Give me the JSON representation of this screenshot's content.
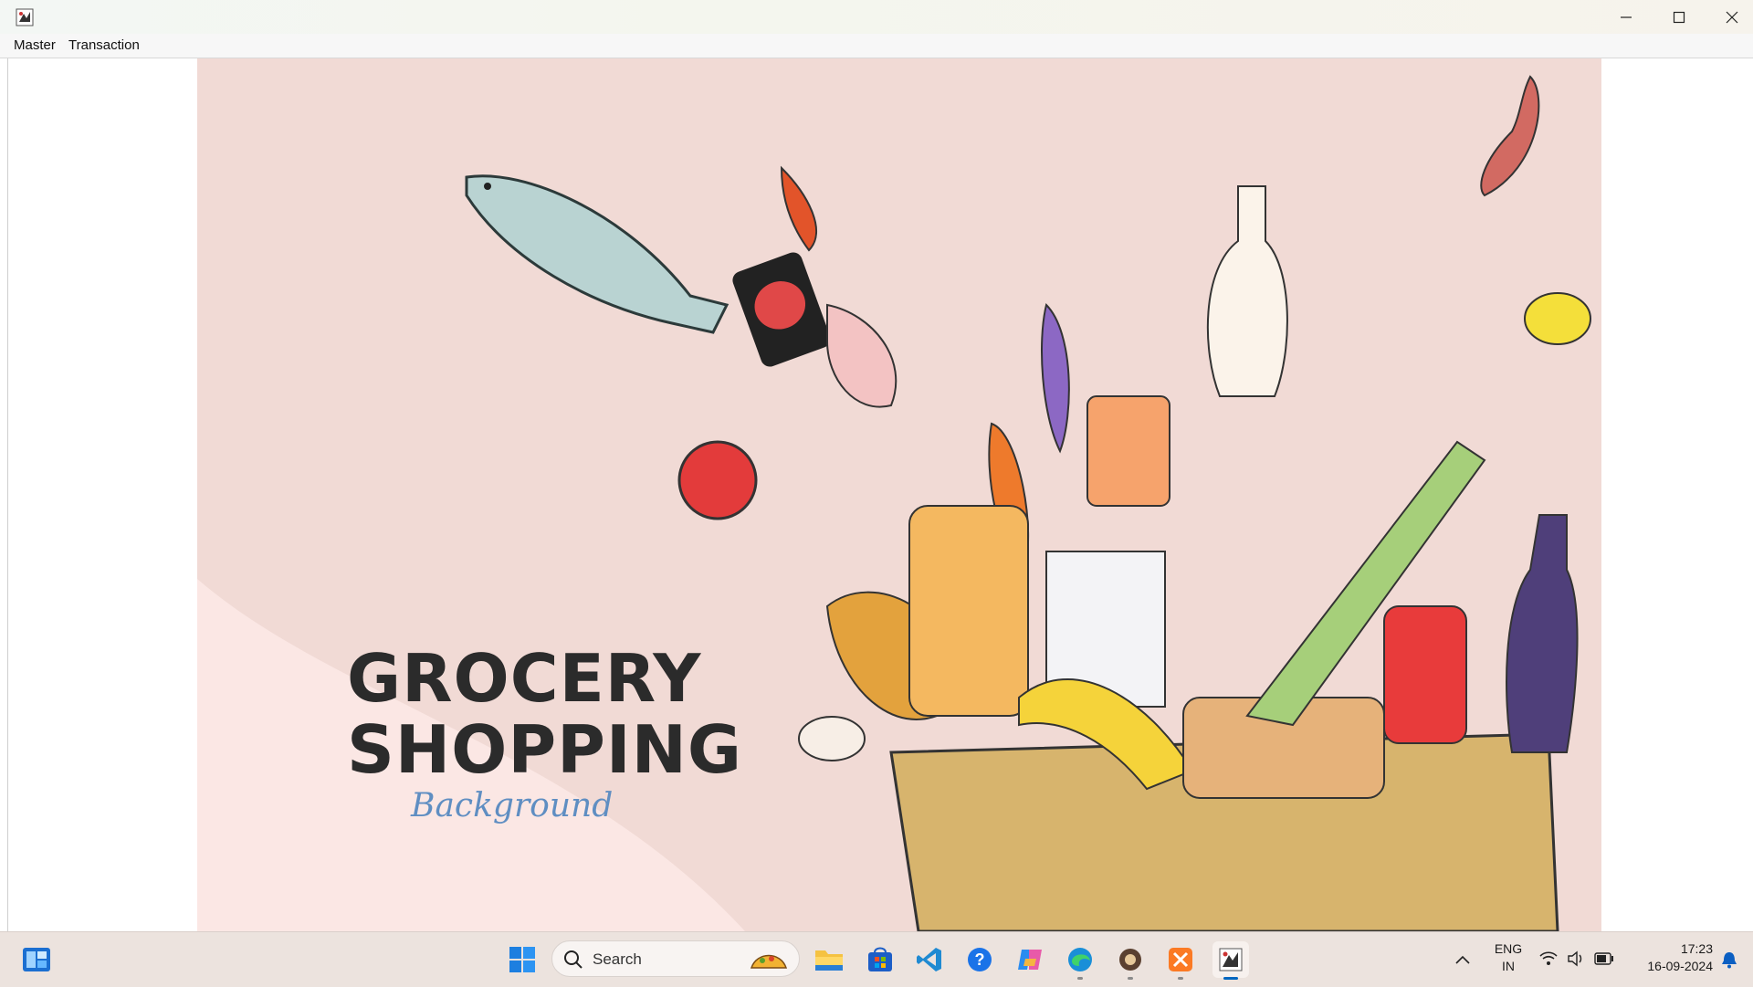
{
  "menu": {
    "items": [
      "Master",
      "Transaction"
    ]
  },
  "poster": {
    "title_line1": "GROCERY",
    "title_line2": "SHOPPING",
    "subtitle": "Background"
  },
  "taskbar": {
    "search_placeholder": "Search",
    "apps": [
      "widgets-icon",
      "windows-start-icon",
      "file-explorer-icon",
      "microsoft-store-icon",
      "vscode-icon",
      "help-icon",
      "copilot-icon",
      "edge-icon",
      "app-icon",
      "xampp-icon",
      "java-app-icon"
    ],
    "language": "ENG",
    "region": "IN",
    "time": "17:23",
    "date": "16-09-2024"
  },
  "colors": {
    "poster_bg": "#f1dad5",
    "taskbar_bg": "#ece3de",
    "accent": "#0067c0"
  }
}
